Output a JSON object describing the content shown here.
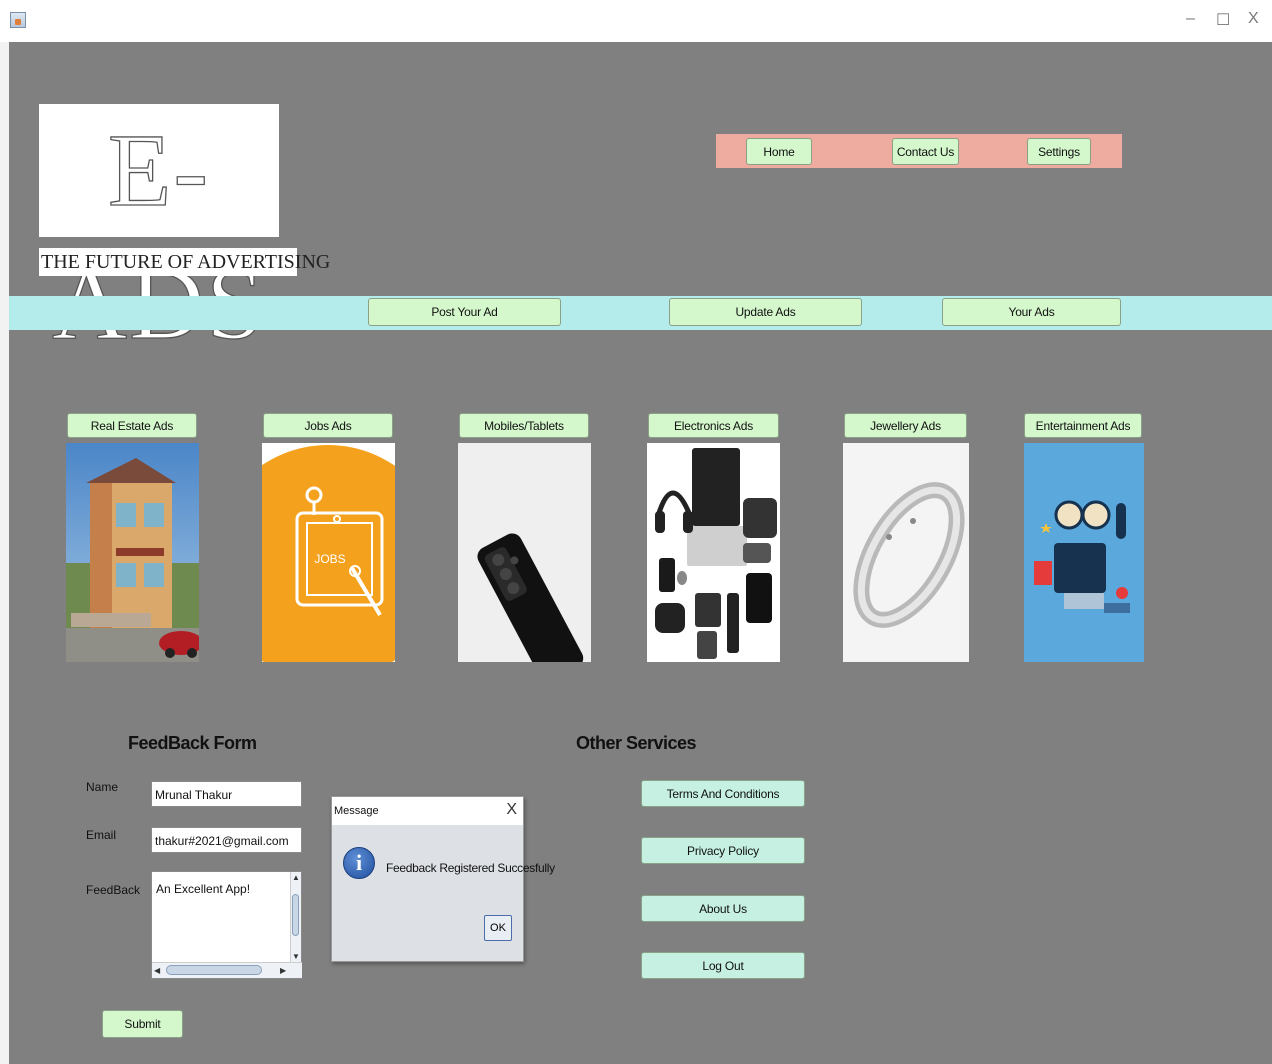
{
  "window": {
    "minimize": "–",
    "maximize": "☐",
    "close": "X"
  },
  "logo": {
    "text": "E-ADS",
    "tagline": "THE FUTURE OF ADVERTISING"
  },
  "top_nav": [
    "Home",
    "Contact Us",
    "Settings"
  ],
  "ad_bar": [
    "Post Your Ad",
    "Update Ads",
    "Your Ads"
  ],
  "categories": [
    {
      "label": "Real Estate Ads"
    },
    {
      "label": "Jobs Ads",
      "image_text": "JOBS"
    },
    {
      "label": "Mobiles/Tablets"
    },
    {
      "label": "Electronics Ads"
    },
    {
      "label": "Jewellery Ads"
    },
    {
      "label": "Entertainment Ads"
    }
  ],
  "feedback": {
    "title": "FeedBack Form",
    "name_label": "Name",
    "name_value": "Mrunal Thakur",
    "email_label": "Email",
    "email_value": "thakur#2021@gmail.com",
    "feedback_label": "FeedBack",
    "feedback_value": "An Excellent App!",
    "submit": "Submit"
  },
  "other_services": {
    "title": "Other Services",
    "buttons": [
      "Terms And Conditions",
      "Privacy Policy",
      "About Us",
      "Log Out"
    ]
  },
  "dialog": {
    "title": "Message",
    "close": "X",
    "icon": "info-icon",
    "message": "Feedback Registered Succesfully",
    "ok": "OK"
  },
  "colors": {
    "background": "#808080",
    "top_nav_bg": "#eeaba0",
    "ad_bar_bg": "#b4ecec",
    "button_green": "#d4f7cc",
    "button_teal": "#c5f0e2"
  }
}
